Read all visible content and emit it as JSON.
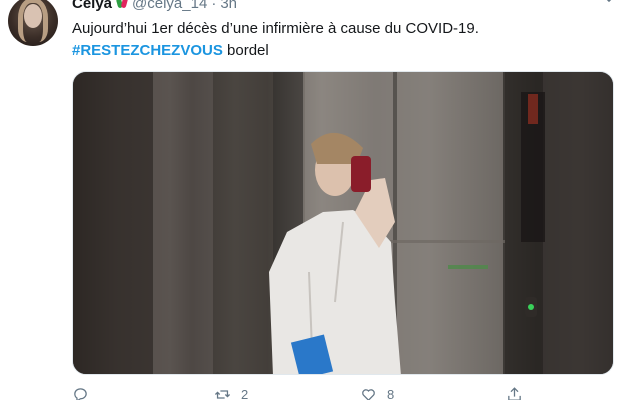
{
  "tweet": {
    "display_name": "Celya",
    "handle": "@celya_14",
    "separator": "·",
    "time": "3h",
    "text_line1": "Aujourd’hui 1er décès d’une infirmière à cause du COVID-19.",
    "hashtag": "#RESTEZCHEZVOUS",
    "text_line2_rest": " bordel",
    "icons": {
      "avatar": "profile-photo",
      "name_emoji": "flower-emoji",
      "more": "chevron-down-icon",
      "reply": "reply-icon",
      "retweet": "retweet-icon",
      "like": "heart-icon",
      "share": "share-icon"
    },
    "actions": {
      "retweet_count": "2",
      "like_count": "8"
    }
  },
  "colors": {
    "text": "#14171a",
    "secondary": "#657786",
    "hashtag": "#1b95e0"
  }
}
